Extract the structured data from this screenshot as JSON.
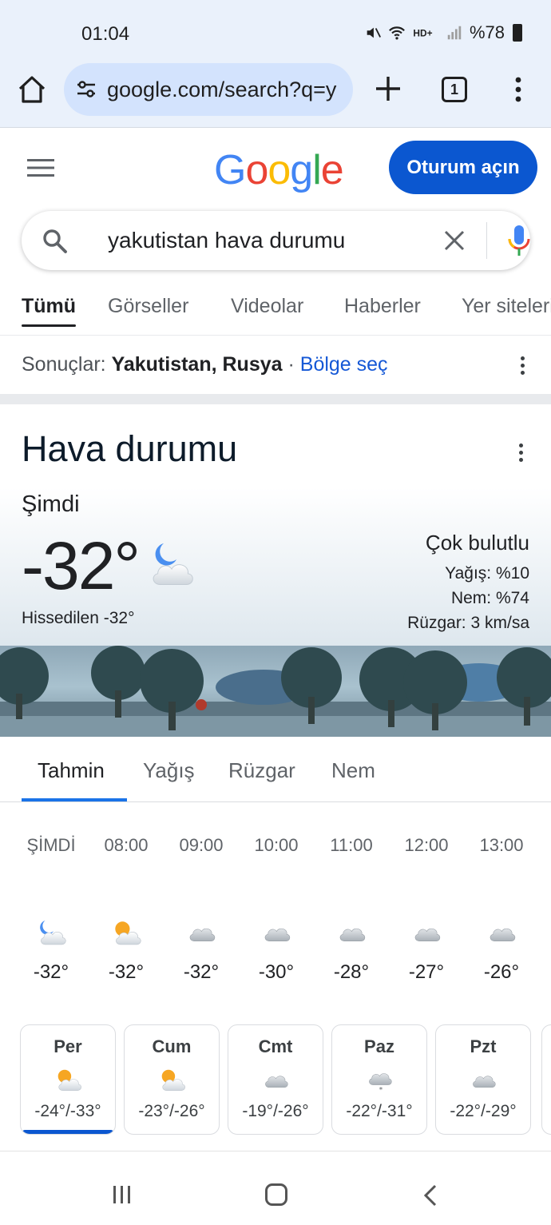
{
  "status_bar": {
    "time": "01:04",
    "battery": "%78"
  },
  "browser": {
    "url": "google.com/search?q=y",
    "tab_count": "1"
  },
  "header": {
    "logo": [
      "G",
      "o",
      "o",
      "g",
      "l",
      "e"
    ],
    "logo_colors": [
      "#4285f4",
      "#ea4335",
      "#fbbc05",
      "#4285f4",
      "#34a853",
      "#ea4335"
    ],
    "signin_label": "Oturum açın"
  },
  "search": {
    "query": "yakutistan hava durumu"
  },
  "result_tabs": [
    "Tümü",
    "Görseller",
    "Videolar",
    "Haberler",
    "Yer siteleri"
  ],
  "results_line": {
    "prefix": "Sonuçlar: ",
    "location": "Yakutistan, Rusya",
    "sep": " · ",
    "link": "Bölge seç"
  },
  "weather": {
    "title": "Hava durumu",
    "now_label": "Şimdi",
    "temp": "-32°",
    "feels_like": "Hissedilen -32°",
    "condition": "Çok bulutlu",
    "precip": "Yağış: %10",
    "humidity": "Nem: %74",
    "wind": "Rüzgar: 3 km/sa"
  },
  "forecast_tabs": [
    "Tahmin",
    "Yağış",
    "Rüzgar",
    "Nem"
  ],
  "hourly": [
    {
      "time": "ŞİMDİ",
      "temp": "-32°",
      "icon": "moon-cloud-icon"
    },
    {
      "time": "08:00",
      "temp": "-32°",
      "icon": "sun-cloud-icon"
    },
    {
      "time": "09:00",
      "temp": "-32°",
      "icon": "cloud-icon"
    },
    {
      "time": "10:00",
      "temp": "-30°",
      "icon": "cloud-icon"
    },
    {
      "time": "11:00",
      "temp": "-28°",
      "icon": "cloud-icon"
    },
    {
      "time": "12:00",
      "temp": "-27°",
      "icon": "cloud-icon"
    },
    {
      "time": "13:00",
      "temp": "-26°",
      "icon": "cloud-icon"
    }
  ],
  "daily": [
    {
      "day": "Per",
      "range": "-24°/-33°",
      "icon": "sun-cloud-icon",
      "selected": true
    },
    {
      "day": "Cum",
      "range": "-23°/-26°",
      "icon": "sun-cloud-icon",
      "selected": false
    },
    {
      "day": "Cmt",
      "range": "-19°/-26°",
      "icon": "cloud-icon",
      "selected": false
    },
    {
      "day": "Paz",
      "range": "-22°/-31°",
      "icon": "snow-cloud-icon",
      "selected": false
    },
    {
      "day": "Pzt",
      "range": "-22°/-29°",
      "icon": "cloud-icon",
      "selected": false
    }
  ],
  "colors": {
    "accent": "#0b57d0",
    "link": "#1558d6",
    "chrome_bg": "#eaf1fb",
    "url_bg": "#d3e3fd",
    "tab_underline": "#1a73e8"
  }
}
